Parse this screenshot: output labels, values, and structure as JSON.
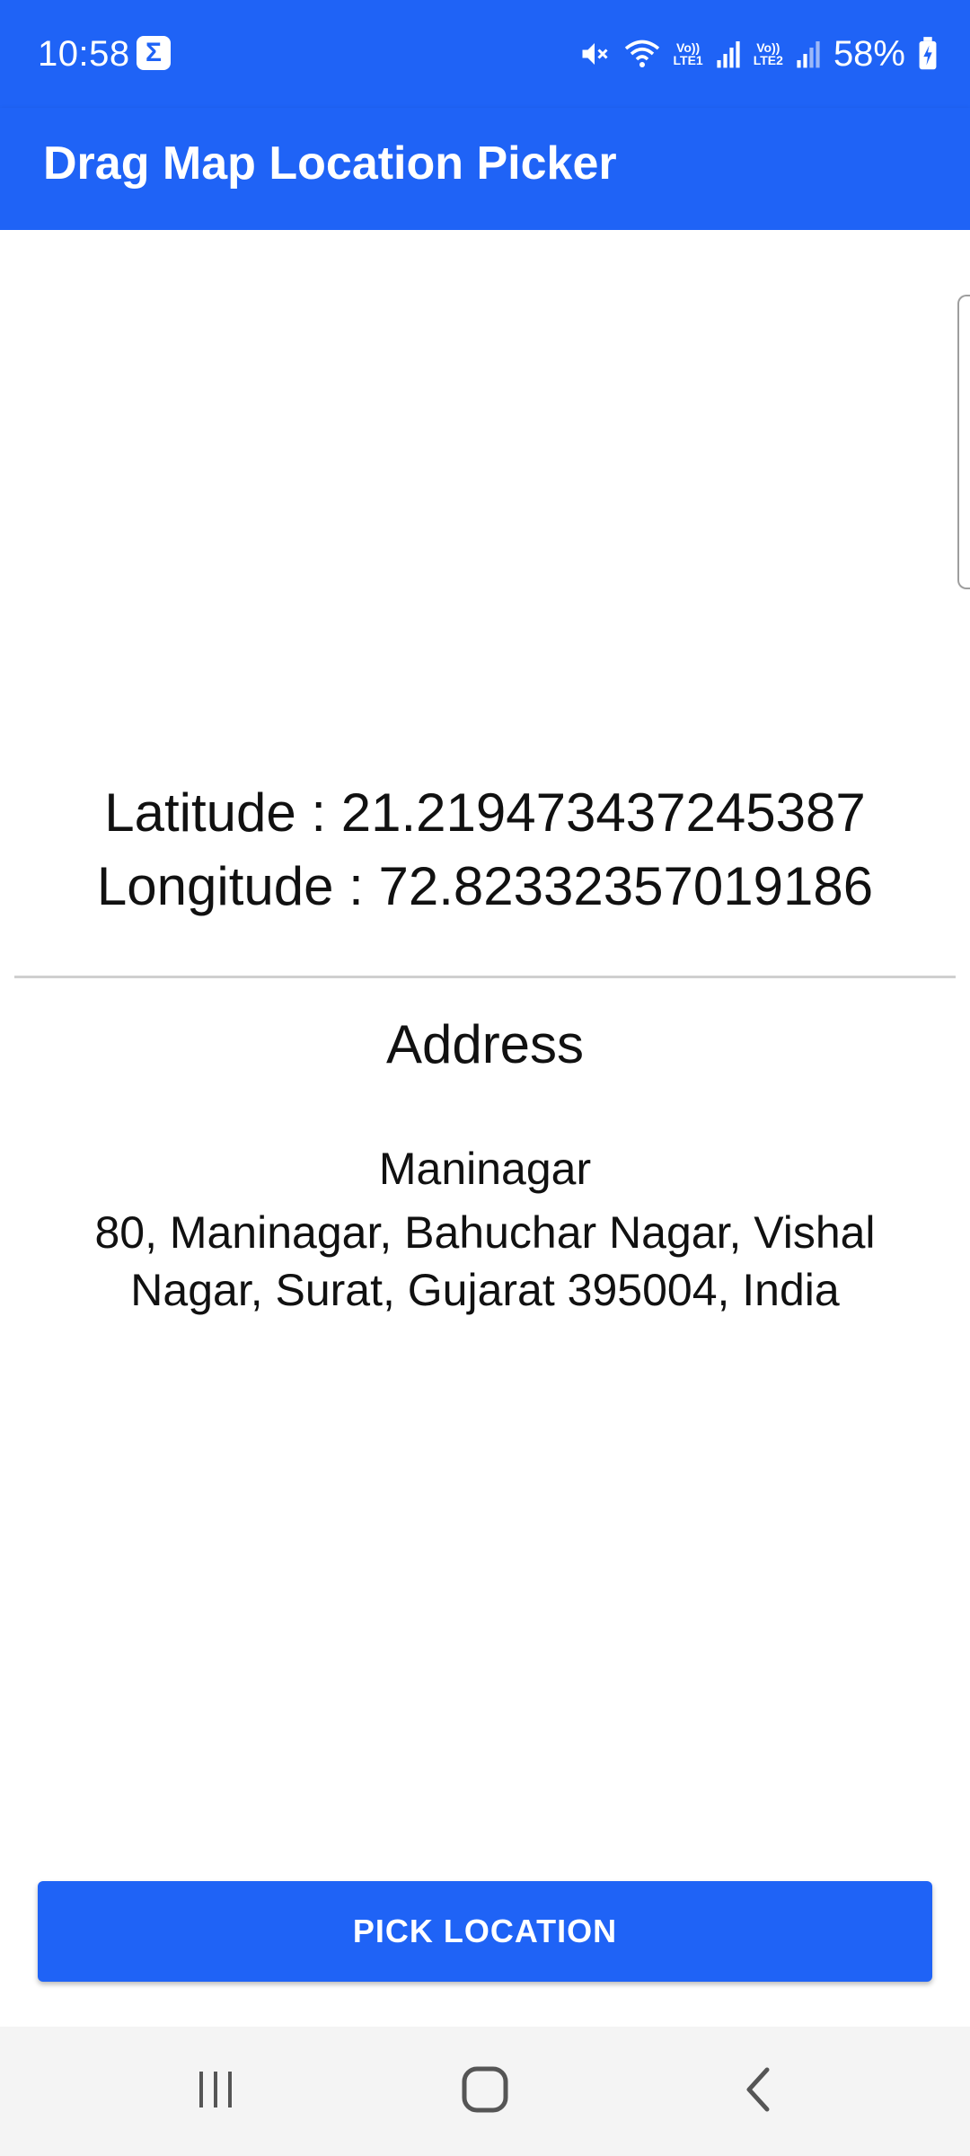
{
  "status_bar": {
    "time": "10:58",
    "notification_icon": "sigma-icon",
    "battery": "58%",
    "sim1": {
      "top": "Vo))",
      "bottom": "LTE1"
    },
    "sim2": {
      "top": "Vo))",
      "bottom": "LTE2"
    },
    "icons": [
      "mute-icon",
      "wifi-icon",
      "signal-icon",
      "signal-icon",
      "battery-charging-icon"
    ]
  },
  "app_bar": {
    "title": "Drag Map Location Picker"
  },
  "location": {
    "latitude_line": "Latitude : 21.219473437245387",
    "longitude_line": "Longitude : 72.82332357019186"
  },
  "address": {
    "heading": "Address",
    "place_name": "Maninagar",
    "full_address": "80, Maninagar, Bahuchar Nagar, Vishal Nagar, Surat, Gujarat 395004, India"
  },
  "pick_button": {
    "label": "PICK LOCATION"
  },
  "nav_bar": {
    "icons": [
      "recents-icon",
      "home-icon",
      "back-icon"
    ]
  },
  "colors": {
    "primary": "#1f63f6",
    "nav_background": "#f4f4f4",
    "divider": "#cfcfcf"
  }
}
